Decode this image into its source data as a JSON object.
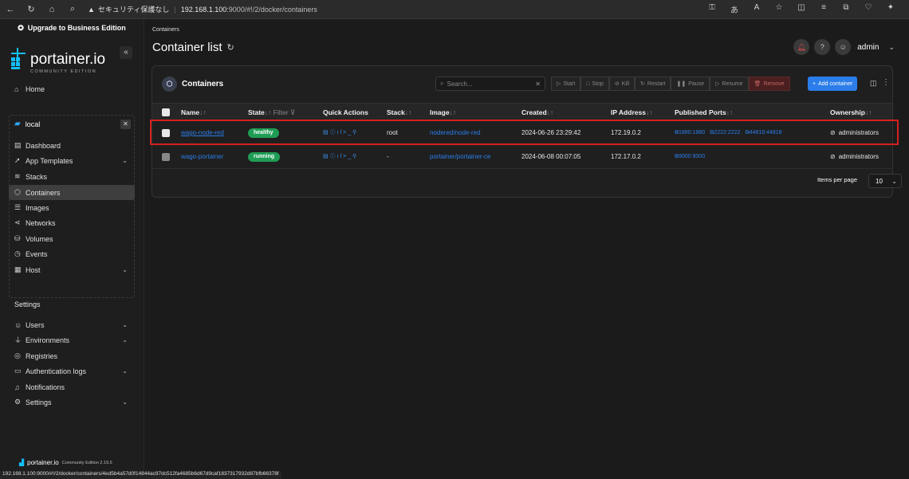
{
  "browser": {
    "security": "セキュリティ保護なし",
    "url_host": "192.168.1.100",
    "url_rest": ":9000/#!/2/docker/containers"
  },
  "sidebar": {
    "upgrade": "Upgrade to Business Edition",
    "logo": "portainer.io",
    "logo_sub": "COMMUNITY EDITION",
    "home": "Home",
    "env_name": "local",
    "env_items": [
      "Dashboard",
      "App Templates",
      "Stacks",
      "Containers",
      "Images",
      "Networks",
      "Volumes",
      "Events",
      "Host"
    ],
    "settings_title": "Settings",
    "settings_items": [
      "Users",
      "Environments",
      "Registries",
      "Authentication logs",
      "Notifications",
      "Settings"
    ],
    "footer_logo": "portainer.io",
    "footer_edition": "Community Edition 2.19.5"
  },
  "header": {
    "breadcrumb": "Containers",
    "title": "Container list",
    "user": "admin"
  },
  "panel": {
    "title": "Containers",
    "search_placeholder": "Search...",
    "actions": [
      "Start",
      "Stop",
      "Kill",
      "Restart",
      "Pause",
      "Resume",
      "Remove"
    ],
    "add_button": "Add container"
  },
  "table": {
    "headers": {
      "name": "Name",
      "state": "State",
      "filter": "Filter",
      "quick_actions": "Quick Actions",
      "stack": "Stack",
      "image": "Image",
      "created": "Created",
      "ip": "IP Address",
      "ports": "Published Ports",
      "ownership": "Ownership"
    },
    "rows": [
      {
        "name": "wago-node-red",
        "state": "healthy",
        "stack": "root",
        "image": "nodered/node-red",
        "created": "2024-06-26 23:29:42",
        "ip": "172.19.0.2",
        "ports": [
          "1880:1880",
          "2222:2222",
          "44818:44818"
        ],
        "ownership": "administrators"
      },
      {
        "name": "wago-portainer",
        "state": "running",
        "stack": "-",
        "image": "portainer/portainer-ce",
        "created": "2024-06-08 00:07:05",
        "ip": "172.17.0.2",
        "ports": [
          "9000:9000"
        ],
        "ownership": "administrators"
      }
    ],
    "items_per_page_label": "Items per page",
    "items_per_page": "10"
  },
  "statusbar": "192.168.1.100:9000/#!/2/docker/containers/4ed5b4a57d0f14844ac97dc512fa4685b6d67d9caf1837317932d87bfb66378f"
}
